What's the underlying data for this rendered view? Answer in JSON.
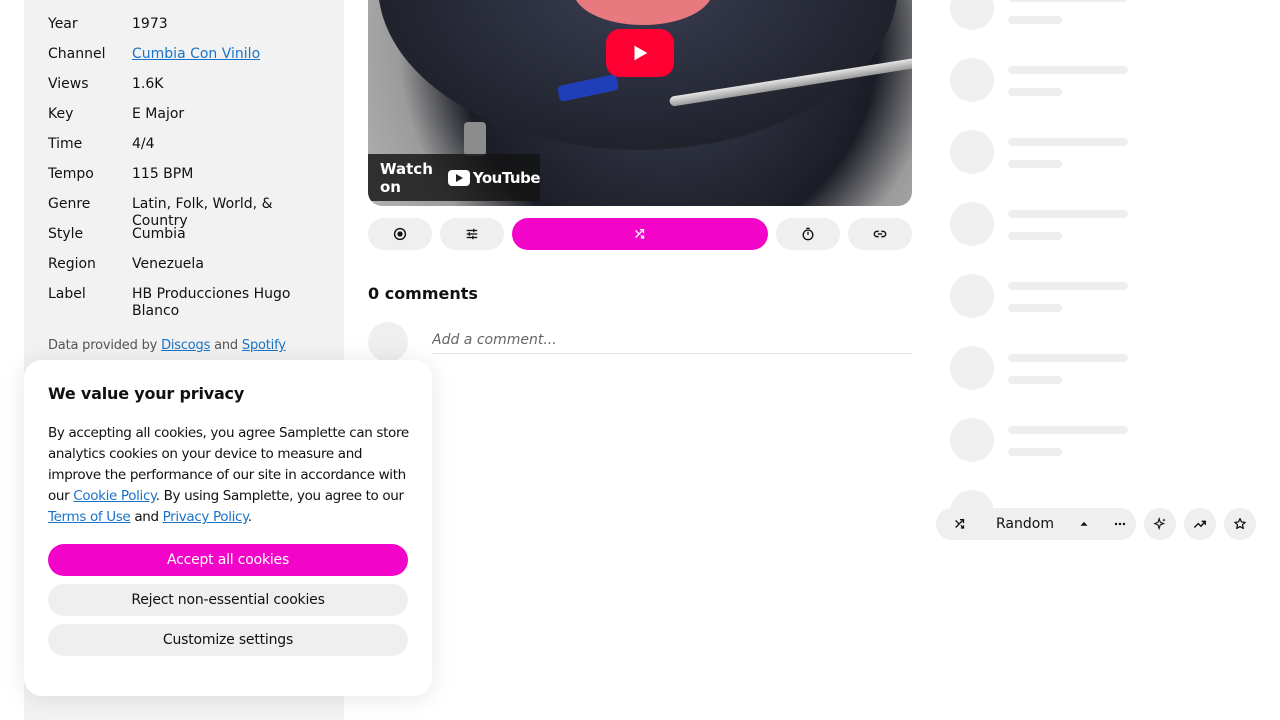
{
  "details": {
    "rows": [
      {
        "key": "Year",
        "value": "1973"
      },
      {
        "key": "Channel",
        "value": "Cumbia Con Vinilo",
        "link": true
      },
      {
        "key": "Views",
        "value": "1.6K"
      },
      {
        "key": "Key",
        "value": "E Major"
      },
      {
        "key": "Time",
        "value": "4/4"
      },
      {
        "key": "Tempo",
        "value": "115 BPM"
      },
      {
        "key": "Genre",
        "value": "Latin, Folk, World, & Country"
      },
      {
        "key": "Style",
        "value": "Cumbia"
      },
      {
        "key": "Region",
        "value": "Venezuela"
      },
      {
        "key": "Label",
        "value": "HB Producciones Hugo Blanco"
      }
    ],
    "credit_prefix": "Data provided by",
    "credit_source1": "Discogs",
    "credit_and": "and",
    "credit_source2": "Spotify"
  },
  "video": {
    "watch_on": "Watch on",
    "youtube": "YouTube"
  },
  "controls": {
    "record_icon": "record-icon",
    "mixer_icon": "sliders-icon",
    "shuffle_icon": "shuffle-icon",
    "timer_icon": "stopwatch-icon",
    "link_icon": "link-icon",
    "accent": "#f205c8"
  },
  "comments": {
    "title": "0 comments",
    "placeholder": "Add a comment..."
  },
  "player": {
    "mode_label": "Random",
    "icons": [
      "shuffle-icon",
      "chevron-up-icon",
      "more-icon",
      "sparkle-icon",
      "trending-icon",
      "star-icon"
    ]
  },
  "cookie": {
    "title": "We value your privacy",
    "body_1": "By accepting all cookies, you agree Samplette can store analytics cookies on your device to measure and improve the performance of our site in accordance with our ",
    "cookie_policy": "Cookie Policy",
    "body_2": ". By using Samplette, you agree to our ",
    "terms": "Terms of Use",
    "body_3": " and ",
    "privacy": "Privacy Policy",
    "body_4": ".",
    "accept": "Accept all cookies",
    "reject": "Reject non-essential cookies",
    "customize": "Customize settings"
  }
}
